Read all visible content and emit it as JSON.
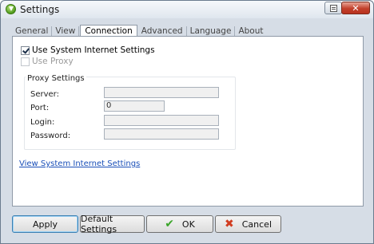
{
  "window": {
    "title": "Settings"
  },
  "titlebar": {
    "help_icon": "help-icon",
    "close_icon": "close-icon",
    "close_glyph": "✕"
  },
  "tabs": [
    {
      "label": "General"
    },
    {
      "label": "View"
    },
    {
      "label": "Connection"
    },
    {
      "label": "Advanced"
    },
    {
      "label": "Language"
    },
    {
      "label": "About"
    }
  ],
  "active_tab": "Connection",
  "connection": {
    "use_system_settings": {
      "label": "Use System Internet Settings",
      "checked": true
    },
    "use_proxy": {
      "label": "Use Proxy",
      "checked": false,
      "enabled": false
    },
    "proxy_group": {
      "title": "Proxy Settings",
      "server": {
        "label": "Server:",
        "value": ""
      },
      "port": {
        "label": "Port:",
        "value": "0"
      },
      "login": {
        "label": "Login:",
        "value": ""
      },
      "password": {
        "label": "Password:",
        "value": ""
      }
    },
    "link_label": "View System Internet Settings"
  },
  "buttons": {
    "apply": "Apply",
    "default_settings": "Default Settings",
    "ok": "OK",
    "cancel": "Cancel",
    "ok_icon": "checkmark-icon",
    "cancel_icon": "x-icon",
    "ok_glyph": "✔",
    "cancel_glyph": "✖"
  }
}
